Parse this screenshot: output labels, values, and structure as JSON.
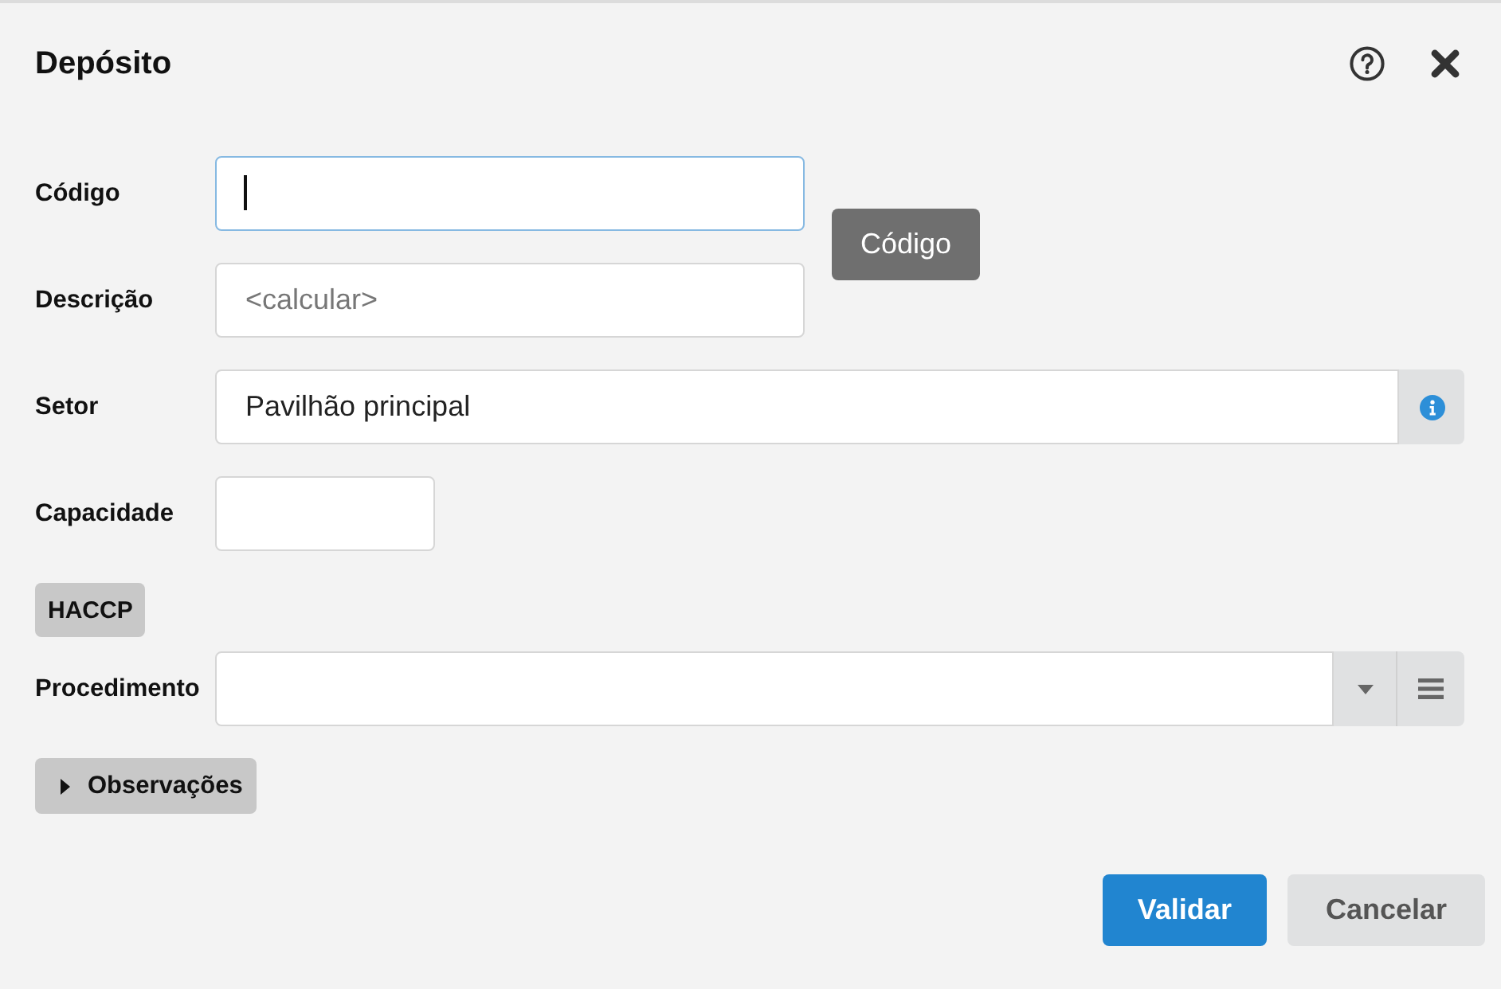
{
  "dialog": {
    "title": "Depósito"
  },
  "form": [
    {
      "kind": "text",
      "label": "Código",
      "focused": true,
      "tooltip": "Código"
    },
    {
      "kind": "text",
      "label": "Descrição",
      "placeholder": "<calcular>",
      "focused": false
    },
    {
      "kind": "lookup",
      "label": "Setor",
      "value": "Pavilhão principal",
      "focused": false
    },
    {
      "kind": "number",
      "label": "Capacidade",
      "focused": false
    },
    {
      "kind": "heading",
      "label": "HACCP"
    },
    {
      "kind": "select",
      "label": "Procedimento",
      "focused": false
    },
    {
      "kind": "collapsible",
      "label": "Observações",
      "expanded": false
    }
  ],
  "buttons": [
    {
      "kind": "primary",
      "label": "Validar"
    },
    {
      "kind": "secondary",
      "label": "Cancelar"
    }
  ]
}
